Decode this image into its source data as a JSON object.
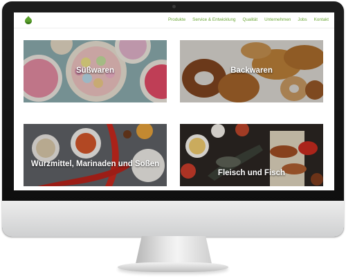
{
  "nav": {
    "items": [
      "Produkte",
      "Service & Entwicklung",
      "Qualität",
      "Unternehmen",
      "Jobs",
      "Kontakt"
    ]
  },
  "tiles": [
    {
      "title": "Süßwaren"
    },
    {
      "title": "Backwaren"
    },
    {
      "title": "Würzmittel, Marinaden und Soßen"
    },
    {
      "title": "Fleisch und Fisch"
    }
  ],
  "colors": {
    "brand_green": "#6aa634",
    "monitor_bezel": "#111111",
    "monitor_chin": "#dcdcdc"
  }
}
